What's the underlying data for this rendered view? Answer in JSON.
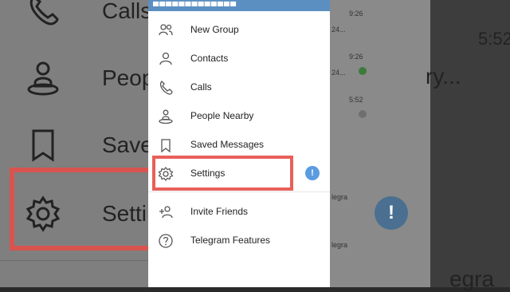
{
  "menu": {
    "items": [
      {
        "label": "New Group",
        "icon": "people-icon"
      },
      {
        "label": "Contacts",
        "icon": "person-icon"
      },
      {
        "label": "Calls",
        "icon": "phone-icon"
      },
      {
        "label": "People Nearby",
        "icon": "nearby-icon"
      },
      {
        "label": "Saved Messages",
        "icon": "bookmark-icon"
      },
      {
        "label": "Settings",
        "icon": "gear-icon",
        "badge": "!"
      },
      {
        "label": "Invite Friends",
        "icon": "add-person-icon"
      },
      {
        "label": "Telegram Features",
        "icon": "question-icon"
      }
    ]
  },
  "background_left": {
    "rows": [
      "Calls",
      "Peop",
      "Save",
      "Setti"
    ]
  },
  "background_chats": {
    "times": [
      "9:26",
      "9:26",
      "5:52"
    ],
    "snippets": [
      "24...",
      "24...",
      "legra",
      "legra"
    ],
    "big_time": "5:52",
    "big_snippet": "ry...",
    "big_footer": "egra"
  },
  "fab": {
    "label": "!"
  },
  "colors": {
    "accent": "#5b9be0",
    "highlight": "#e8605a",
    "header": "#5b8fc2"
  }
}
